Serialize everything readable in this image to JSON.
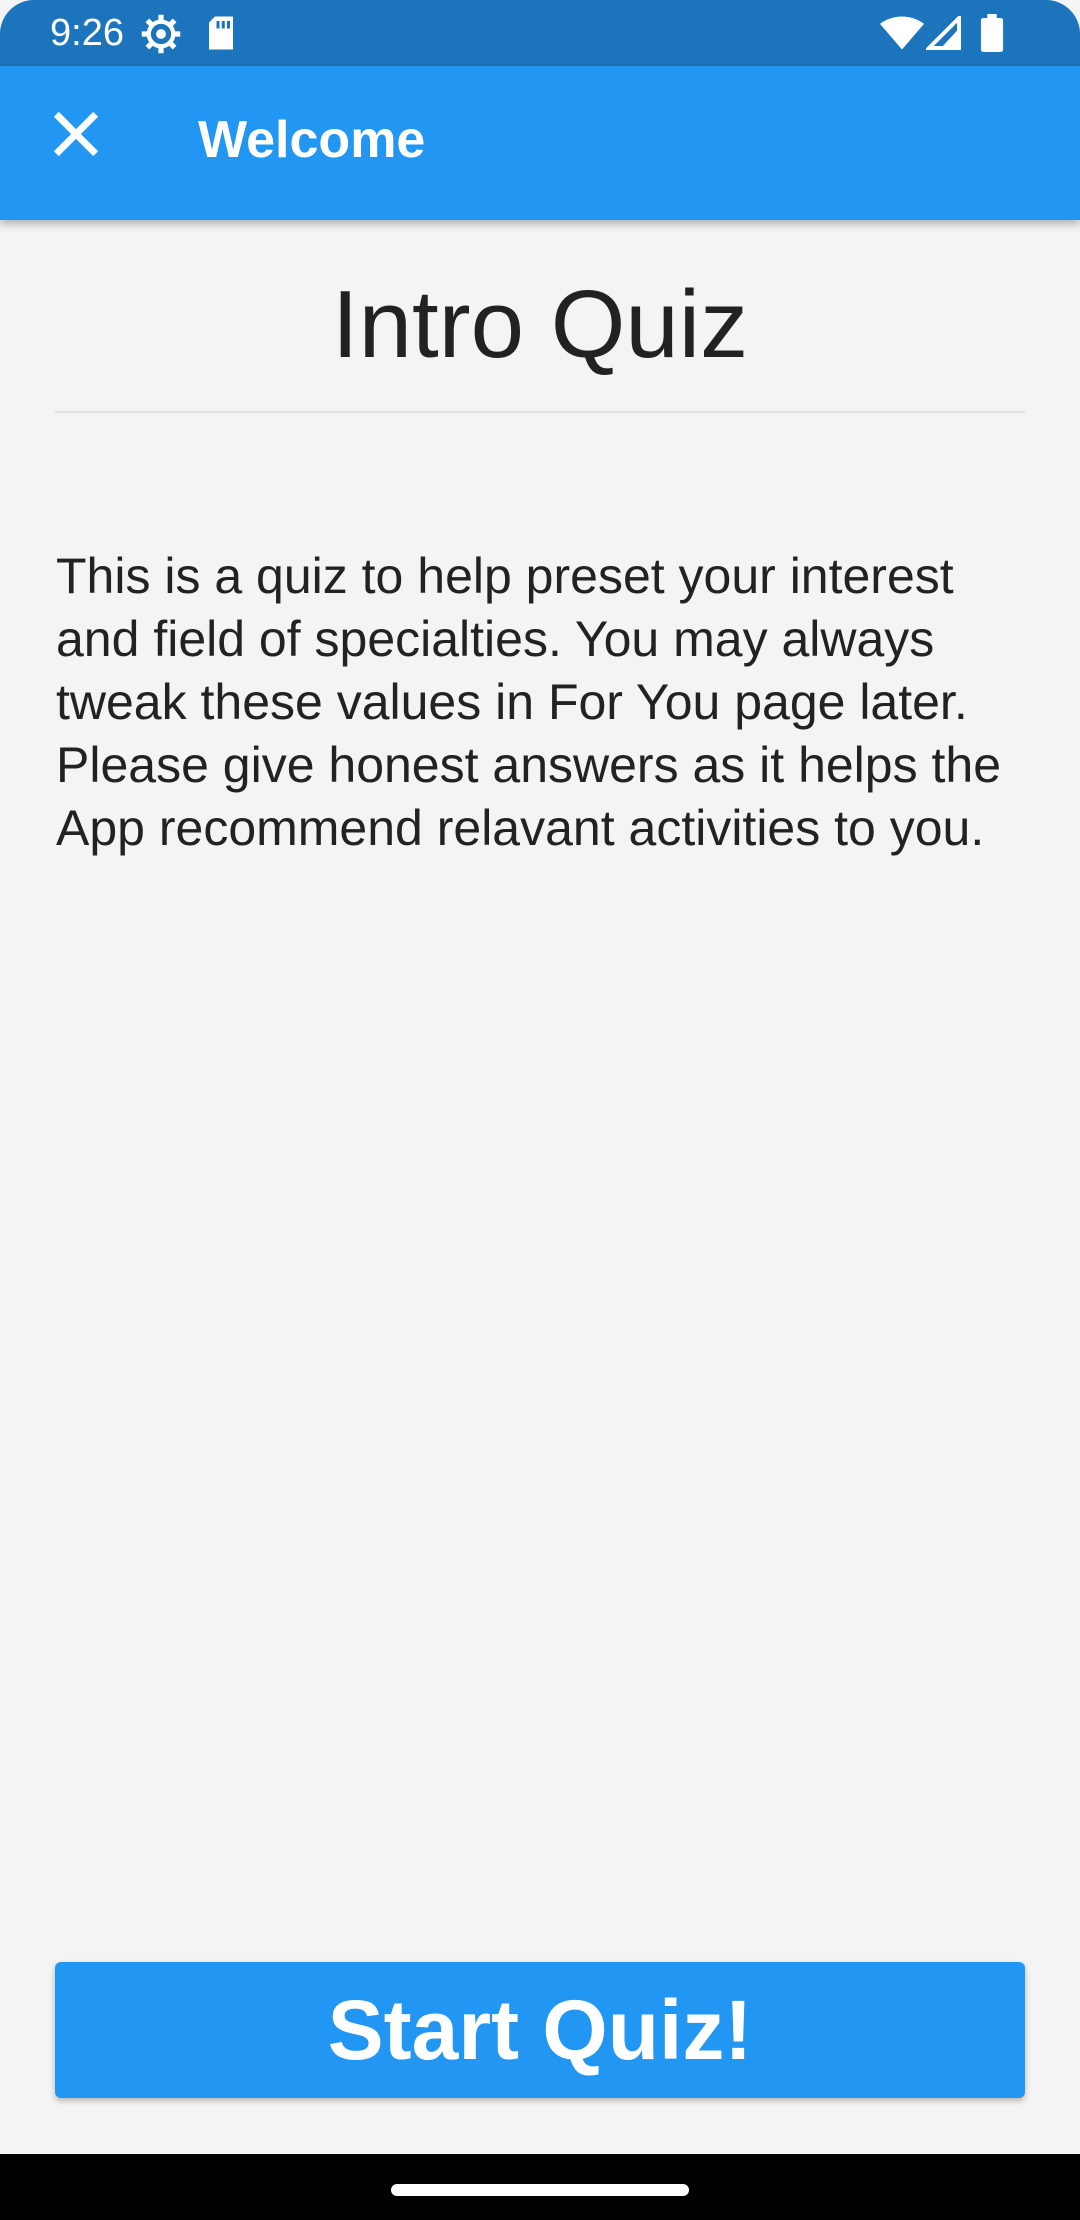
{
  "status_bar": {
    "time": "9:26",
    "icons": [
      "settings-gear-icon",
      "sd-card-icon",
      "wifi-icon",
      "cell-signal-icon",
      "battery-icon"
    ],
    "background": "#1c74bd"
  },
  "app_bar": {
    "title": "Welcome",
    "close_icon": "close-icon",
    "background": "#2196f3"
  },
  "main": {
    "title": "Intro Quiz",
    "description": "This is a quiz to help preset your interest and field of specialties. You may always tweak these values in For You page later. Please give honest answers as it helps the App recommend relavant activities to you.",
    "start_button_label": "Start Quiz!",
    "accent_color": "#2196f3"
  }
}
